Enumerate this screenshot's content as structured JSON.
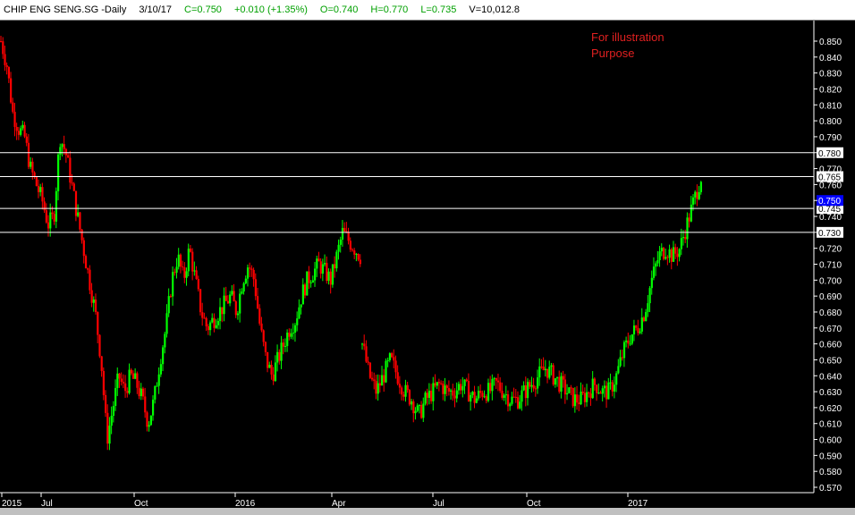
{
  "header": {
    "symbol": "CHIP ENG SENG.SG -Daily",
    "date": "3/10/17",
    "close": "C=0.750",
    "change": "+0.010 (+1.35%)",
    "open": "O=0.740",
    "high": "H=0.770",
    "low": "L=0.735",
    "volume": "V=10,012.8"
  },
  "annotation": {
    "line1": "For illustration",
    "line2": "Purpose"
  },
  "colors": {
    "up": "#00ff00",
    "down": "#ff0000",
    "background": "#000000",
    "axis": "#ffffff",
    "current_price_box": "#0000ff"
  },
  "chart_data": {
    "type": "candlestick",
    "ylim": [
      0.565,
      0.855
    ],
    "y_ticks": [
      "0.570",
      "0.580",
      "0.590",
      "0.600",
      "0.610",
      "0.620",
      "0.630",
      "0.640",
      "0.650",
      "0.660",
      "0.670",
      "0.680",
      "0.690",
      "0.700",
      "0.710",
      "0.720",
      "0.730",
      "0.740",
      "0.750",
      "0.760",
      "0.770",
      "0.780",
      "0.790",
      "0.800",
      "0.810",
      "0.820",
      "0.830",
      "0.840",
      "0.850"
    ],
    "x_labels": [
      "2015",
      "Jul",
      "Oct",
      "2016",
      "Apr",
      "Jul",
      "Oct",
      "2017"
    ],
    "horizontal_lines": [
      {
        "value": 0.78,
        "label": "0.780"
      },
      {
        "value": 0.765,
        "label": "0.765"
      },
      {
        "value": 0.745,
        "label": "0.745"
      },
      {
        "value": 0.73,
        "label": "0.730"
      }
    ],
    "last_price": {
      "value": 0.75,
      "label": "0.750"
    },
    "price_path": [
      [
        0.85,
        1
      ],
      [
        0.835,
        5
      ],
      [
        0.805,
        5
      ],
      [
        0.795,
        4
      ],
      [
        0.79,
        4
      ],
      [
        0.77,
        4
      ],
      [
        0.76,
        3
      ],
      [
        0.75,
        2
      ],
      [
        0.735,
        3
      ],
      [
        0.74,
        3
      ],
      [
        0.79,
        5
      ],
      [
        0.78,
        3
      ],
      [
        0.76,
        2
      ],
      [
        0.74,
        4
      ],
      [
        0.72,
        4
      ],
      [
        0.7,
        4
      ],
      [
        0.68,
        4
      ],
      [
        0.65,
        5
      ],
      [
        0.6,
        7
      ],
      [
        0.62,
        3
      ],
      [
        0.64,
        4
      ],
      [
        0.63,
        4
      ],
      [
        0.64,
        4
      ],
      [
        0.635,
        3
      ],
      [
        0.625,
        3
      ],
      [
        0.61,
        4
      ],
      [
        0.625,
        3
      ],
      [
        0.65,
        4
      ],
      [
        0.67,
        5
      ],
      [
        0.7,
        5
      ],
      [
        0.715,
        5
      ],
      [
        0.7,
        4
      ],
      [
        0.72,
        4
      ],
      [
        0.7,
        3
      ],
      [
        0.68,
        4
      ],
      [
        0.67,
        4
      ],
      [
        0.675,
        4
      ],
      [
        0.68,
        4
      ],
      [
        0.685,
        4
      ],
      [
        0.69,
        5
      ],
      [
        0.68,
        4
      ],
      [
        0.7,
        5
      ],
      [
        0.71,
        5
      ],
      [
        0.7,
        4
      ],
      [
        0.67,
        5
      ],
      [
        0.65,
        4
      ],
      [
        0.64,
        4
      ],
      [
        0.65,
        4
      ],
      [
        0.66,
        4
      ],
      [
        0.67,
        4
      ],
      [
        0.675,
        4
      ],
      [
        0.69,
        4
      ],
      [
        0.7,
        5
      ],
      [
        0.705,
        4
      ],
      [
        0.71,
        4
      ],
      [
        0.705,
        4
      ],
      [
        0.7,
        4
      ],
      [
        0.715,
        5
      ],
      [
        0.73,
        5
      ],
      [
        0.725,
        4
      ],
      [
        0.72,
        4
      ],
      [
        0.715,
        3
      ]
    ],
    "gap_after_index": 61,
    "price_path_2": [
      [
        0.66,
        6
      ],
      [
        0.64,
        6
      ],
      [
        0.63,
        5
      ],
      [
        0.64,
        4
      ],
      [
        0.65,
        4
      ],
      [
        0.64,
        4
      ],
      [
        0.63,
        4
      ],
      [
        0.625,
        4
      ],
      [
        0.615,
        5
      ],
      [
        0.625,
        4
      ],
      [
        0.63,
        4
      ],
      [
        0.635,
        4
      ],
      [
        0.63,
        3
      ],
      [
        0.63,
        3
      ],
      [
        0.635,
        3
      ],
      [
        0.63,
        3
      ],
      [
        0.625,
        4
      ],
      [
        0.63,
        3
      ],
      [
        0.63,
        3
      ],
      [
        0.635,
        3
      ],
      [
        0.63,
        3
      ],
      [
        0.625,
        4
      ],
      [
        0.625,
        3
      ],
      [
        0.63,
        3
      ],
      [
        0.635,
        4
      ],
      [
        0.64,
        4
      ],
      [
        0.645,
        4
      ],
      [
        0.64,
        4
      ],
      [
        0.635,
        4
      ],
      [
        0.63,
        4
      ],
      [
        0.625,
        4
      ],
      [
        0.625,
        3
      ],
      [
        0.63,
        3
      ],
      [
        0.635,
        4
      ],
      [
        0.63,
        3
      ],
      [
        0.63,
        3
      ],
      [
        0.64,
        4
      ],
      [
        0.655,
        5
      ],
      [
        0.665,
        5
      ],
      [
        0.67,
        4
      ],
      [
        0.68,
        5
      ],
      [
        0.7,
        5
      ],
      [
        0.715,
        5
      ],
      [
        0.72,
        4
      ],
      [
        0.715,
        4
      ],
      [
        0.72,
        4
      ],
      [
        0.735,
        5
      ],
      [
        0.75,
        6
      ],
      [
        0.765,
        6
      ]
    ]
  }
}
